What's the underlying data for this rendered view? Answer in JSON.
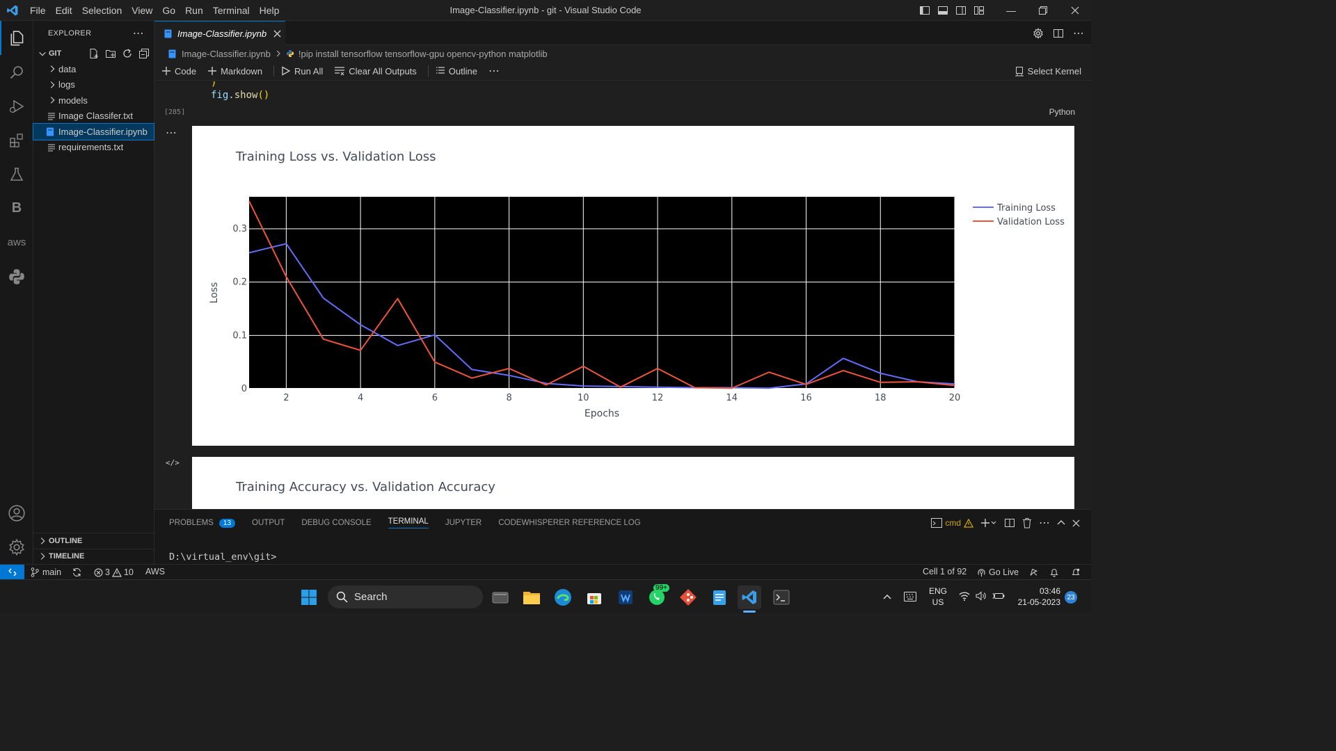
{
  "window": {
    "title": "Image-Classifier.ipynb - git - Visual Studio Code"
  },
  "menu": [
    "File",
    "Edit",
    "Selection",
    "View",
    "Go",
    "Run",
    "Terminal",
    "Help"
  ],
  "sidebar": {
    "header": "EXPLORER",
    "root": "GIT",
    "items": [
      {
        "label": "data",
        "type": "folder"
      },
      {
        "label": "logs",
        "type": "folder"
      },
      {
        "label": "models",
        "type": "folder"
      },
      {
        "label": "Image Classifer.txt",
        "type": "file"
      },
      {
        "label": "Image-Classifier.ipynb",
        "type": "notebook",
        "selected": true
      },
      {
        "label": "requirements.txt",
        "type": "file"
      }
    ],
    "outline": "OUTLINE",
    "timeline": "TIMELINE"
  },
  "tab": {
    "label": "Image-Classifier.ipynb"
  },
  "breadcrumb": {
    "file": "Image-Classifier.ipynb",
    "cell": "!pip install tensorflow tensorflow-gpu opencv-python matplotlib"
  },
  "toolbar": {
    "code": "Code",
    "markdown": "Markdown",
    "run_all": "Run All",
    "clear_outputs": "Clear All Outputs",
    "outline": "Outline",
    "more": "⋯",
    "select_kernel": "Select Kernel"
  },
  "cell": {
    "code_paren": ")",
    "code_line": "fig.show()",
    "exec_count": "[285]",
    "language": "Python",
    "ellipsis": "⋯",
    "html_marker": "</>"
  },
  "chart_data": [
    {
      "type": "line",
      "title": "Training Loss vs. Validation Loss",
      "xlabel": "Epochs",
      "ylabel": "Loss",
      "xlim": [
        1,
        20
      ],
      "ylim": [
        0,
        0.36
      ],
      "xticks": [
        2,
        4,
        6,
        8,
        10,
        12,
        14,
        16,
        18,
        20
      ],
      "yticks": [
        0,
        0.1,
        0.2,
        0.3
      ],
      "ytick_labels": [
        "0",
        "0.1",
        "0.2",
        "0.3"
      ],
      "background": "#000000",
      "grid": true,
      "legend_position": "top-right",
      "x": [
        1,
        2,
        3,
        4,
        5,
        6,
        7,
        8,
        9,
        10,
        11,
        12,
        13,
        14,
        15,
        16,
        17,
        18,
        19,
        20
      ],
      "series": [
        {
          "name": "Training Loss",
          "color": "#636efa",
          "values": [
            0.255,
            0.272,
            0.17,
            0.12,
            0.081,
            0.101,
            0.036,
            0.025,
            0.01,
            0.005,
            0.004,
            0.003,
            0.002,
            0.002,
            0.001,
            0.009,
            0.057,
            0.029,
            0.013,
            0.009
          ]
        },
        {
          "name": "Validation Loss",
          "color": "#ef553b",
          "values": [
            0.352,
            0.21,
            0.093,
            0.072,
            0.169,
            0.05,
            0.02,
            0.038,
            0.007,
            0.042,
            0.003,
            0.038,
            0.002,
            0.001,
            0.031,
            0.008,
            0.034,
            0.012,
            0.013,
            0.006
          ]
        }
      ]
    },
    {
      "type": "line",
      "title": "Training Accuracy vs. Validation Accuracy"
    }
  ],
  "panel": {
    "tabs": [
      "PROBLEMS",
      "OUTPUT",
      "DEBUG CONSOLE",
      "TERMINAL",
      "JUPYTER",
      "CODEWHISPERER REFERENCE LOG"
    ],
    "problems_count": "13",
    "active_tab": "TERMINAL",
    "terminal_name": "cmd",
    "prompt": "D:\\virtual_env\\git>"
  },
  "status": {
    "branch": "main",
    "errors": "3",
    "warnings": "10",
    "aws": "AWS",
    "cell_pos": "Cell 1 of 92",
    "go_live": "Go Live"
  },
  "taskbar": {
    "search": "Search",
    "whatsapp_badge": "99+",
    "lang_top": "ENG",
    "lang_bottom": "US",
    "time": "03:46",
    "date": "21-05-2023",
    "notif": "23"
  },
  "colors": {
    "accent": "#0078d4",
    "training": "#636efa",
    "validation": "#ef553b"
  }
}
